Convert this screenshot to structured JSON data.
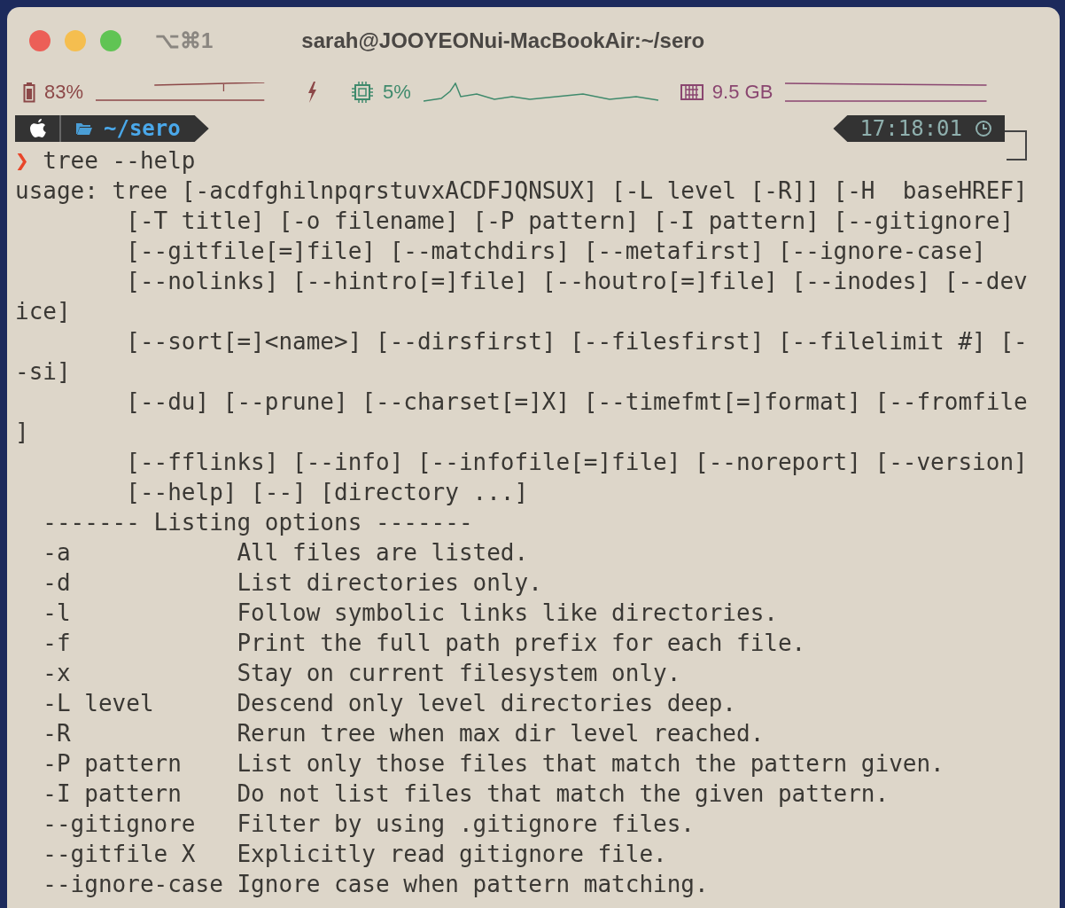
{
  "window": {
    "title": "sarah@JOOYEONui-MacBookAir:~/sero",
    "shortcut": "⌥⌘1"
  },
  "status_bar": {
    "meters": [
      {
        "kind": "battery",
        "reading": "83%",
        "color": "#8c4848",
        "charging": true
      },
      {
        "kind": "cpu",
        "reading": "5%",
        "color": "#3f8a6c",
        "charging": false
      },
      {
        "kind": "memory",
        "reading": "9.5 GB",
        "color": "#8a4670",
        "charging": false
      }
    ]
  },
  "prompt": {
    "path": "~/sero",
    "time": "17:18:01"
  },
  "command": {
    "symbol": "❯",
    "text": "tree --help"
  },
  "output": [
    "usage: tree [-acdfghilnpqrstuvxACDFJQNSUX] [-L level [-R]] [-H  baseHREF]",
    "        [-T title] [-o filename] [-P pattern] [-I pattern] [--gitignore]",
    "        [--gitfile[=]file] [--matchdirs] [--metafirst] [--ignore-case]",
    "        [--nolinks] [--hintro[=]file] [--houtro[=]file] [--inodes] [--dev",
    "ice]",
    "        [--sort[=]<name>] [--dirsfirst] [--filesfirst] [--filelimit #] [-",
    "-si]",
    "        [--du] [--prune] [--charset[=]X] [--timefmt[=]format] [--fromfile",
    "]",
    "        [--fflinks] [--info] [--infofile[=]file] [--noreport] [--version]",
    "        [--help] [--] [directory ...]",
    "  ------- Listing options -------",
    "  -a            All files are listed.",
    "  -d            List directories only.",
    "  -l            Follow symbolic links like directories.",
    "  -f            Print the full path prefix for each file.",
    "  -x            Stay on current filesystem only.",
    "  -L level      Descend only level directories deep.",
    "  -R            Rerun tree when max dir level reached.",
    "  -P pattern    List only those files that match the pattern given.",
    "  -I pattern    Do not list files that match the given pattern.",
    "  --gitignore   Filter by using .gitignore files.",
    "  --gitfile X   Explicitly read gitignore file.",
    "  --ignore-case Ignore case when pattern matching."
  ]
}
